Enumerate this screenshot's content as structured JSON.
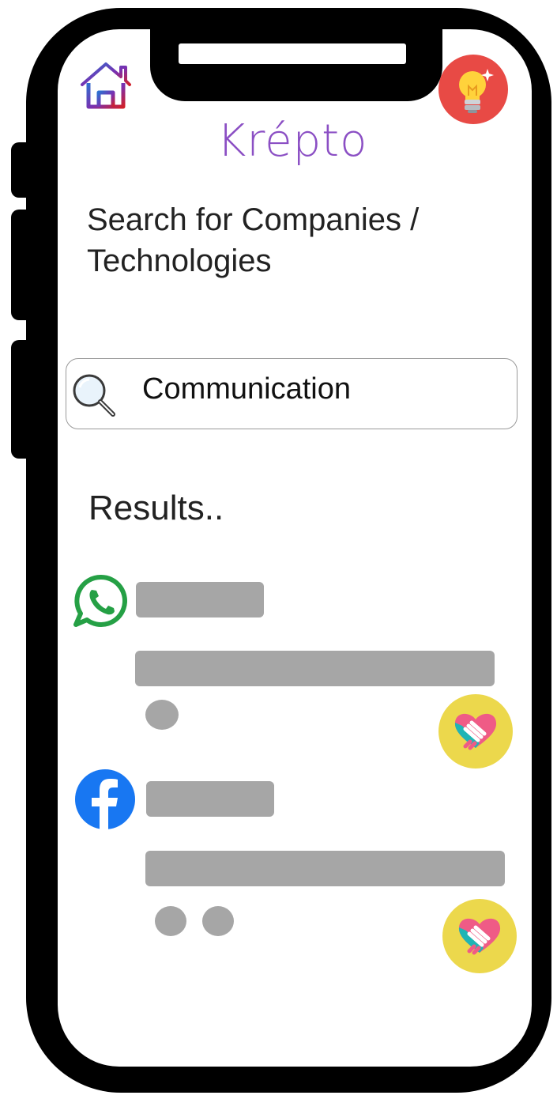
{
  "header": {
    "home_icon": "home-icon",
    "idea_icon": "lightbulb-icon",
    "app_name": "Krépto",
    "subtitle": "Search for Companies / Technologies"
  },
  "search": {
    "icon": "magnifier-icon",
    "value": "Communication"
  },
  "results": {
    "title": "Results..",
    "items": [
      {
        "logo": "whatsapp-icon",
        "placeholder_dots": 1,
        "action_icon": "handshake-icon"
      },
      {
        "logo": "facebook-icon",
        "placeholder_dots": 2,
        "action_icon": "handshake-icon"
      }
    ]
  },
  "colors": {
    "brand": "#8b4fc4",
    "idea_button": "#e84a45",
    "deal_button": "#ecd84c",
    "placeholder": "#a6a6a6",
    "whatsapp": "#25a045",
    "facebook": "#1877f2"
  }
}
